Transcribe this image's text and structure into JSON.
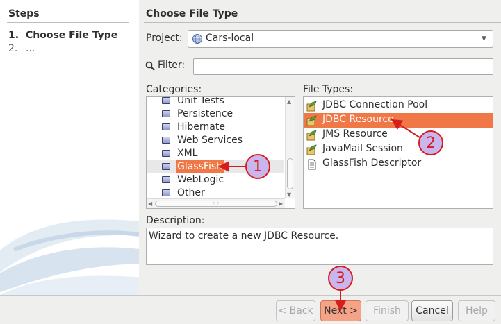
{
  "steps": {
    "title": "Steps",
    "items": [
      {
        "number": "1.",
        "label": "Choose File Type"
      },
      {
        "number": "2.",
        "label": "..."
      }
    ]
  },
  "section_title": "Choose File Type",
  "project": {
    "label": "Project:",
    "value": "Cars-local",
    "icon": "globe-icon"
  },
  "filter": {
    "label": "Filter:",
    "value": "",
    "icon": "search-icon"
  },
  "categories": {
    "label": "Categories:",
    "items": [
      "Unit Tests",
      "Persistence",
      "Hibernate",
      "Web Services",
      "XML",
      "GlassFish",
      "WebLogic",
      "Other"
    ],
    "selected": "GlassFish"
  },
  "file_types": {
    "label": "File Types:",
    "items": [
      "JDBC Connection Pool",
      "JDBC Resource",
      "JMS Resource",
      "JavaMail Session",
      "GlassFish Descriptor"
    ],
    "selected": "JDBC Resource"
  },
  "description": {
    "label": "Description:",
    "text": "Wizard to create a new JDBC Resource."
  },
  "buttons": {
    "back": "< Back",
    "next": "Next >",
    "finish": "Finish",
    "cancel": "Cancel",
    "help": "Help"
  },
  "annotations": [
    "1",
    "2",
    "3"
  ],
  "colors": {
    "selection": "#f07746",
    "annotation_stroke": "#d61c1c",
    "annotation_fill": "#c9b6ef"
  }
}
